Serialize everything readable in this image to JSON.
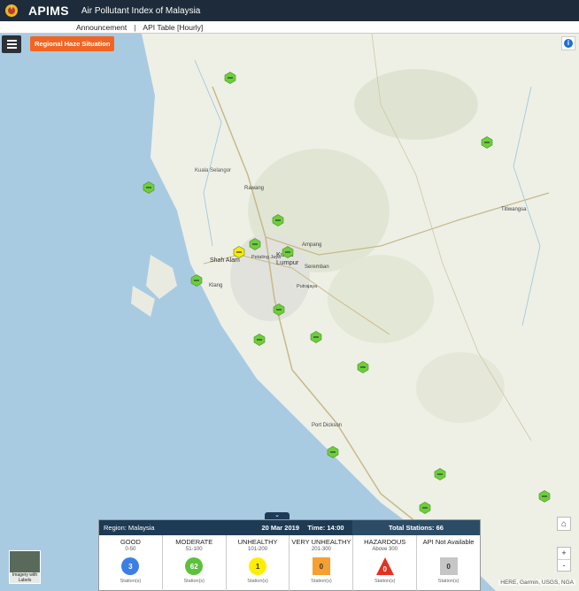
{
  "header": {
    "brand": "APIMS",
    "subtitle": "Air Pollutant Index of Malaysia",
    "links": [
      "Announcement",
      "API Table [Hourly]"
    ]
  },
  "map": {
    "region_button": "Regional Haze Situation",
    "attribution": "HERE, Garmin, USGS, NGA",
    "basemap_label": "Imagery with Labels",
    "zoom_in": "+",
    "zoom_out": "-",
    "place_names": [
      "Kuala Selangor",
      "Shah Alam",
      "Kuala Lumpur",
      "Klang",
      "Port Dickson",
      "Ampang",
      "Rawang",
      "Petaling Jaya",
      "Putrajaya",
      "Seremban",
      "Titiwangsa"
    ]
  },
  "stations": [
    {
      "status": "good"
    },
    {
      "status": "good"
    },
    {
      "status": "good"
    },
    {
      "status": "good"
    },
    {
      "status": "moderate"
    },
    {
      "status": "good"
    },
    {
      "status": "good"
    },
    {
      "status": "good"
    },
    {
      "status": "good"
    },
    {
      "status": "good"
    },
    {
      "status": "good"
    },
    {
      "status": "good"
    },
    {
      "status": "good"
    },
    {
      "status": "good"
    },
    {
      "status": "good"
    },
    {
      "status": "good"
    }
  ],
  "legend": {
    "region": "Region: Malaysia",
    "date": "20 Mar 2019",
    "time": "Time: 14:00",
    "total": "Total Stations: 66",
    "categories": [
      {
        "name": "GOOD",
        "range": "0-50",
        "count": "3",
        "label": "Station(s)",
        "color": "#3b7fe6",
        "shape": "circle"
      },
      {
        "name": "MODERATE",
        "range": "51-100",
        "count": "62",
        "label": "Station(s)",
        "color": "#5cc13d",
        "shape": "circle"
      },
      {
        "name": "UNHEALTHY",
        "range": "101-200",
        "count": "1",
        "label": "Station(s)",
        "color": "#ffee00",
        "shape": "circle"
      },
      {
        "name": "VERY UNHEALTHY",
        "range": "201-300",
        "count": "0",
        "label": "Station(s)",
        "color": "#f5a031",
        "shape": "square"
      },
      {
        "name": "HAZARDOUS",
        "range": "Above 300",
        "count": "0",
        "label": "Station(s)",
        "color": "#e53021",
        "shape": "triangle"
      },
      {
        "name": "API Not Available",
        "range": "",
        "count": "0",
        "label": "Station(s)",
        "color": "#c6c6c6",
        "shape": "square"
      }
    ]
  },
  "colors": {
    "header_bg": "#1d2b3a",
    "accent": "#f26522",
    "sea": "#a5c8e0"
  }
}
